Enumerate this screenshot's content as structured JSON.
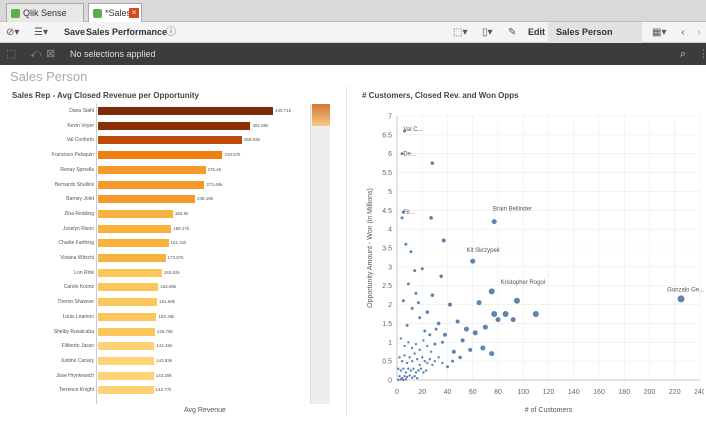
{
  "tabs": [
    {
      "label": "Qlik Sense Desktop hub"
    },
    {
      "label": "*Sales Perfor..."
    }
  ],
  "toolbar": {
    "save_label": "Save",
    "app_name": "Sales Performance",
    "edit_label": "Edit",
    "sheet_label": "Sales Person"
  },
  "selections": {
    "text": "No selections applied"
  },
  "sheet_title": "Sales Person",
  "left_chart_title": "Sales Rep - Avg Closed Revenue per Opportunity",
  "right_chart_title": "# Customers, Closed Rev. and Won Opps",
  "chart_data": [
    {
      "type": "bar",
      "orientation": "horizontal",
      "title": "Sales Rep - Avg Closed Revenue per Opportunity",
      "xlabel": "Avg Revenue",
      "categories": [
        "Dana Stahl",
        "Kevin Voyer",
        "Val Conforto",
        "Francisco Peloquin",
        "Renay Spinella",
        "Bernardo Shullick",
        "Barney Jolet",
        "Zina Redding",
        "Joselyn Rison",
        "Charlie Farthing",
        "Viviana Witschi",
        "Lon Rink",
        "Carole Koonz",
        "Theron Shawver",
        "Louis Leamon",
        "Shelby Ruvalcaba",
        "Filiberto Jasso",
        "Justine Canary",
        "Jose Hrynkewich",
        "Terrence Knight"
      ],
      "values": [
        449.71,
        391.85,
        369.83,
        319.57,
        276.4,
        273.48,
        249.19,
        192.5,
        188.17,
        181.31,
        173.87,
        163.82,
        154.88,
        151.69,
        150.26,
        145.79,
        144.45,
        143.93,
        143.28,
        142.77
      ],
      "value_labels": [
        "449.71k",
        "391.85k",
        "369.83k",
        "319.57k",
        "276.4k",
        "273.48k",
        "249.19k",
        "192.5k",
        "188.17k",
        "181.31k",
        "173.87k",
        "163.82k",
        "154.88k",
        "151.69k",
        "150.26k",
        "145.79k",
        "144.45k",
        "143.93k",
        "143.28k",
        "142.77k"
      ],
      "colors": [
        "#7f2a08",
        "#8c3008",
        "#bf4a08",
        "#f07f13",
        "#f7992a",
        "#f7992a",
        "#f7992a",
        "#f9b23f",
        "#f9b23f",
        "#f9b23f",
        "#f9b23f",
        "#fbc65a",
        "#fbc65a",
        "#fbc65a",
        "#fbc65a",
        "#fbc65a",
        "#fdd375",
        "#fdd375",
        "#fdd375",
        "#fdd375"
      ]
    },
    {
      "type": "scatter",
      "title": "# Customers, Closed Rev. and Won Opps",
      "xlabel": "# of Customers",
      "ylabel": "Opportunity Amount - Won (in Millions)",
      "xlim": [
        0,
        240
      ],
      "ylim": [
        0,
        7
      ],
      "xticks": [
        0,
        20,
        40,
        60,
        80,
        100,
        120,
        140,
        160,
        180,
        200,
        220,
        240
      ],
      "yticks": [
        0,
        0.5,
        1,
        1.5,
        2,
        2.5,
        3,
        3.5,
        4,
        4.5,
        5,
        5.5,
        6,
        6.5,
        7
      ],
      "point_color": "#4b77a9",
      "labels": [
        {
          "text": "Val C...",
          "x": 5,
          "y": 6.6
        },
        {
          "text": "De...",
          "x": 5,
          "y": 5.95
        },
        {
          "text": "Fil...",
          "x": 5,
          "y": 4.4
        },
        {
          "text": "Brain Bellinder",
          "x": 76,
          "y": 4.5
        },
        {
          "text": "Kit Skrzypek",
          "x": 55,
          "y": 3.4
        },
        {
          "text": "Kristopher Rogol",
          "x": 82,
          "y": 2.55
        },
        {
          "text": "Gonzalo Ge...",
          "x": 214,
          "y": 2.35
        }
      ],
      "points": [
        {
          "x": 6,
          "y": 6.6,
          "r": 1.5
        },
        {
          "x": 4,
          "y": 6.0,
          "r": 1.5
        },
        {
          "x": 28,
          "y": 5.75,
          "r": 1.8
        },
        {
          "x": 5,
          "y": 4.45,
          "r": 1.5
        },
        {
          "x": 77,
          "y": 4.2,
          "r": 2.5
        },
        {
          "x": 4,
          "y": 4.3,
          "r": 1.5
        },
        {
          "x": 27,
          "y": 4.3,
          "r": 1.8
        },
        {
          "x": 37,
          "y": 3.7,
          "r": 2
        },
        {
          "x": 60,
          "y": 3.15,
          "r": 2.5
        },
        {
          "x": 7,
          "y": 3.6,
          "r": 1.5
        },
        {
          "x": 11,
          "y": 3.4,
          "r": 1.5
        },
        {
          "x": 14,
          "y": 2.9,
          "r": 1.5
        },
        {
          "x": 20,
          "y": 2.95,
          "r": 1.5
        },
        {
          "x": 35,
          "y": 2.75,
          "r": 1.8
        },
        {
          "x": 75,
          "y": 2.35,
          "r": 3
        },
        {
          "x": 225,
          "y": 2.15,
          "r": 3.5
        },
        {
          "x": 95,
          "y": 2.1,
          "r": 3
        },
        {
          "x": 65,
          "y": 2.05,
          "r": 2.5
        },
        {
          "x": 77,
          "y": 1.75,
          "r": 3
        },
        {
          "x": 86,
          "y": 1.75,
          "r": 3
        },
        {
          "x": 110,
          "y": 1.75,
          "r": 3
        },
        {
          "x": 80,
          "y": 1.6,
          "r": 2.5
        },
        {
          "x": 92,
          "y": 1.6,
          "r": 2.5
        },
        {
          "x": 28,
          "y": 2.25,
          "r": 1.8
        },
        {
          "x": 42,
          "y": 2.0,
          "r": 2
        },
        {
          "x": 48,
          "y": 1.55,
          "r": 2
        },
        {
          "x": 55,
          "y": 1.35,
          "r": 2.5
        },
        {
          "x": 62,
          "y": 1.25,
          "r": 2.5
        },
        {
          "x": 70,
          "y": 1.4,
          "r": 2.5
        },
        {
          "x": 38,
          "y": 1.2,
          "r": 2
        },
        {
          "x": 52,
          "y": 1.05,
          "r": 2
        },
        {
          "x": 45,
          "y": 0.75,
          "r": 2
        },
        {
          "x": 58,
          "y": 0.8,
          "r": 2
        },
        {
          "x": 68,
          "y": 0.85,
          "r": 2.5
        },
        {
          "x": 75,
          "y": 0.7,
          "r": 2.5
        },
        {
          "x": 33,
          "y": 1.5,
          "r": 1.8
        },
        {
          "x": 24,
          "y": 1.8,
          "r": 1.8
        },
        {
          "x": 18,
          "y": 1.65,
          "r": 1.5
        },
        {
          "x": 12,
          "y": 1.9,
          "r": 1.5
        },
        {
          "x": 8,
          "y": 1.45,
          "r": 1.5
        },
        {
          "x": 5,
          "y": 2.1,
          "r": 1.5
        },
        {
          "x": 15,
          "y": 2.3,
          "r": 1.5
        },
        {
          "x": 3,
          "y": 1.1,
          "r": 1.2
        },
        {
          "x": 6,
          "y": 0.9,
          "r": 1.2
        },
        {
          "x": 9,
          "y": 1.0,
          "r": 1.2
        },
        {
          "x": 12,
          "y": 0.85,
          "r": 1.2
        },
        {
          "x": 15,
          "y": 0.95,
          "r": 1.2
        },
        {
          "x": 18,
          "y": 0.8,
          "r": 1.2
        },
        {
          "x": 21,
          "y": 1.05,
          "r": 1.2
        },
        {
          "x": 24,
          "y": 0.9,
          "r": 1.2
        },
        {
          "x": 27,
          "y": 0.75,
          "r": 1.2
        },
        {
          "x": 30,
          "y": 0.95,
          "r": 1.5
        },
        {
          "x": 2,
          "y": 0.6,
          "r": 1.2
        },
        {
          "x": 4,
          "y": 0.5,
          "r": 1.2
        },
        {
          "x": 6,
          "y": 0.65,
          "r": 1.2
        },
        {
          "x": 8,
          "y": 0.45,
          "r": 1.2
        },
        {
          "x": 10,
          "y": 0.6,
          "r": 1.2
        },
        {
          "x": 12,
          "y": 0.5,
          "r": 1.2
        },
        {
          "x": 14,
          "y": 0.7,
          "r": 1.2
        },
        {
          "x": 16,
          "y": 0.55,
          "r": 1.2
        },
        {
          "x": 18,
          "y": 0.4,
          "r": 1.2
        },
        {
          "x": 20,
          "y": 0.6,
          "r": 1.2
        },
        {
          "x": 22,
          "y": 0.5,
          "r": 1.2
        },
        {
          "x": 24,
          "y": 0.45,
          "r": 1.2
        },
        {
          "x": 26,
          "y": 0.55,
          "r": 1.2
        },
        {
          "x": 28,
          "y": 0.4,
          "r": 1.2
        },
        {
          "x": 30,
          "y": 0.5,
          "r": 1.2
        },
        {
          "x": 33,
          "y": 0.6,
          "r": 1.2
        },
        {
          "x": 36,
          "y": 0.45,
          "r": 1.2
        },
        {
          "x": 1,
          "y": 0.3,
          "r": 1.2
        },
        {
          "x": 3,
          "y": 0.25,
          "r": 1.2
        },
        {
          "x": 5,
          "y": 0.3,
          "r": 1.2
        },
        {
          "x": 7,
          "y": 0.2,
          "r": 1.2
        },
        {
          "x": 9,
          "y": 0.3,
          "r": 1.2
        },
        {
          "x": 11,
          "y": 0.25,
          "r": 1.2
        },
        {
          "x": 13,
          "y": 0.3,
          "r": 1.2
        },
        {
          "x": 15,
          "y": 0.2,
          "r": 1.2
        },
        {
          "x": 17,
          "y": 0.25,
          "r": 1.2
        },
        {
          "x": 19,
          "y": 0.3,
          "r": 1.2
        },
        {
          "x": 21,
          "y": 0.2,
          "r": 1.2
        },
        {
          "x": 23,
          "y": 0.25,
          "r": 1.2
        },
        {
          "x": 2,
          "y": 0.1,
          "r": 1.2
        },
        {
          "x": 4,
          "y": 0.05,
          "r": 1.2
        },
        {
          "x": 6,
          "y": 0.1,
          "r": 1.2
        },
        {
          "x": 8,
          "y": 0.08,
          "r": 1.2
        },
        {
          "x": 10,
          "y": 0.12,
          "r": 1.2
        },
        {
          "x": 12,
          "y": 0.06,
          "r": 1.2
        },
        {
          "x": 14,
          "y": 0.1,
          "r": 1.2
        },
        {
          "x": 16,
          "y": 0.05,
          "r": 1.2
        },
        {
          "x": 1,
          "y": 0.0,
          "r": 1.2
        },
        {
          "x": 3,
          "y": 0.02,
          "r": 1.2
        },
        {
          "x": 5,
          "y": 0.0,
          "r": 1.2
        },
        {
          "x": 7,
          "y": 0.02,
          "r": 1.2
        },
        {
          "x": 40,
          "y": 0.35,
          "r": 1.5
        },
        {
          "x": 44,
          "y": 0.5,
          "r": 1.5
        },
        {
          "x": 50,
          "y": 0.6,
          "r": 1.8
        },
        {
          "x": 9,
          "y": 2.55,
          "r": 1.5
        },
        {
          "x": 17,
          "y": 2.05,
          "r": 1.5
        },
        {
          "x": 22,
          "y": 1.3,
          "r": 1.5
        },
        {
          "x": 26,
          "y": 1.2,
          "r": 1.5
        },
        {
          "x": 31,
          "y": 1.35,
          "r": 1.5
        },
        {
          "x": 36,
          "y": 1.0,
          "r": 1.5
        }
      ]
    }
  ]
}
